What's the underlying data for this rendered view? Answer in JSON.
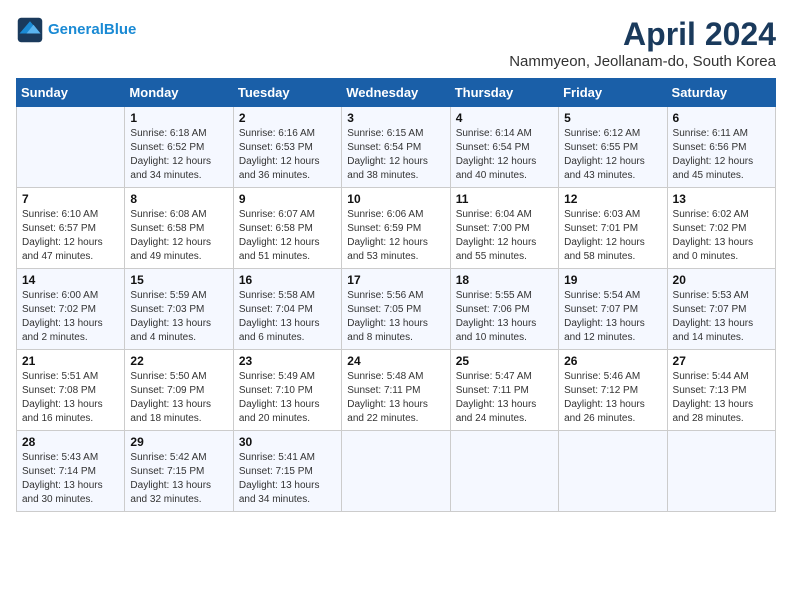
{
  "header": {
    "logo_line1": "General",
    "logo_line2": "Blue",
    "title": "April 2024",
    "subtitle": "Nammyeon, Jeollanam-do, South Korea"
  },
  "weekdays": [
    "Sunday",
    "Monday",
    "Tuesday",
    "Wednesday",
    "Thursday",
    "Friday",
    "Saturday"
  ],
  "weeks": [
    [
      {
        "num": "",
        "detail": ""
      },
      {
        "num": "1",
        "detail": "Sunrise: 6:18 AM\nSunset: 6:52 PM\nDaylight: 12 hours\nand 34 minutes."
      },
      {
        "num": "2",
        "detail": "Sunrise: 6:16 AM\nSunset: 6:53 PM\nDaylight: 12 hours\nand 36 minutes."
      },
      {
        "num": "3",
        "detail": "Sunrise: 6:15 AM\nSunset: 6:54 PM\nDaylight: 12 hours\nand 38 minutes."
      },
      {
        "num": "4",
        "detail": "Sunrise: 6:14 AM\nSunset: 6:54 PM\nDaylight: 12 hours\nand 40 minutes."
      },
      {
        "num": "5",
        "detail": "Sunrise: 6:12 AM\nSunset: 6:55 PM\nDaylight: 12 hours\nand 43 minutes."
      },
      {
        "num": "6",
        "detail": "Sunrise: 6:11 AM\nSunset: 6:56 PM\nDaylight: 12 hours\nand 45 minutes."
      }
    ],
    [
      {
        "num": "7",
        "detail": "Sunrise: 6:10 AM\nSunset: 6:57 PM\nDaylight: 12 hours\nand 47 minutes."
      },
      {
        "num": "8",
        "detail": "Sunrise: 6:08 AM\nSunset: 6:58 PM\nDaylight: 12 hours\nand 49 minutes."
      },
      {
        "num": "9",
        "detail": "Sunrise: 6:07 AM\nSunset: 6:58 PM\nDaylight: 12 hours\nand 51 minutes."
      },
      {
        "num": "10",
        "detail": "Sunrise: 6:06 AM\nSunset: 6:59 PM\nDaylight: 12 hours\nand 53 minutes."
      },
      {
        "num": "11",
        "detail": "Sunrise: 6:04 AM\nSunset: 7:00 PM\nDaylight: 12 hours\nand 55 minutes."
      },
      {
        "num": "12",
        "detail": "Sunrise: 6:03 AM\nSunset: 7:01 PM\nDaylight: 12 hours\nand 58 minutes."
      },
      {
        "num": "13",
        "detail": "Sunrise: 6:02 AM\nSunset: 7:02 PM\nDaylight: 13 hours\nand 0 minutes."
      }
    ],
    [
      {
        "num": "14",
        "detail": "Sunrise: 6:00 AM\nSunset: 7:02 PM\nDaylight: 13 hours\nand 2 minutes."
      },
      {
        "num": "15",
        "detail": "Sunrise: 5:59 AM\nSunset: 7:03 PM\nDaylight: 13 hours\nand 4 minutes."
      },
      {
        "num": "16",
        "detail": "Sunrise: 5:58 AM\nSunset: 7:04 PM\nDaylight: 13 hours\nand 6 minutes."
      },
      {
        "num": "17",
        "detail": "Sunrise: 5:56 AM\nSunset: 7:05 PM\nDaylight: 13 hours\nand 8 minutes."
      },
      {
        "num": "18",
        "detail": "Sunrise: 5:55 AM\nSunset: 7:06 PM\nDaylight: 13 hours\nand 10 minutes."
      },
      {
        "num": "19",
        "detail": "Sunrise: 5:54 AM\nSunset: 7:07 PM\nDaylight: 13 hours\nand 12 minutes."
      },
      {
        "num": "20",
        "detail": "Sunrise: 5:53 AM\nSunset: 7:07 PM\nDaylight: 13 hours\nand 14 minutes."
      }
    ],
    [
      {
        "num": "21",
        "detail": "Sunrise: 5:51 AM\nSunset: 7:08 PM\nDaylight: 13 hours\nand 16 minutes."
      },
      {
        "num": "22",
        "detail": "Sunrise: 5:50 AM\nSunset: 7:09 PM\nDaylight: 13 hours\nand 18 minutes."
      },
      {
        "num": "23",
        "detail": "Sunrise: 5:49 AM\nSunset: 7:10 PM\nDaylight: 13 hours\nand 20 minutes."
      },
      {
        "num": "24",
        "detail": "Sunrise: 5:48 AM\nSunset: 7:11 PM\nDaylight: 13 hours\nand 22 minutes."
      },
      {
        "num": "25",
        "detail": "Sunrise: 5:47 AM\nSunset: 7:11 PM\nDaylight: 13 hours\nand 24 minutes."
      },
      {
        "num": "26",
        "detail": "Sunrise: 5:46 AM\nSunset: 7:12 PM\nDaylight: 13 hours\nand 26 minutes."
      },
      {
        "num": "27",
        "detail": "Sunrise: 5:44 AM\nSunset: 7:13 PM\nDaylight: 13 hours\nand 28 minutes."
      }
    ],
    [
      {
        "num": "28",
        "detail": "Sunrise: 5:43 AM\nSunset: 7:14 PM\nDaylight: 13 hours\nand 30 minutes."
      },
      {
        "num": "29",
        "detail": "Sunrise: 5:42 AM\nSunset: 7:15 PM\nDaylight: 13 hours\nand 32 minutes."
      },
      {
        "num": "30",
        "detail": "Sunrise: 5:41 AM\nSunset: 7:15 PM\nDaylight: 13 hours\nand 34 minutes."
      },
      {
        "num": "",
        "detail": ""
      },
      {
        "num": "",
        "detail": ""
      },
      {
        "num": "",
        "detail": ""
      },
      {
        "num": "",
        "detail": ""
      }
    ]
  ]
}
